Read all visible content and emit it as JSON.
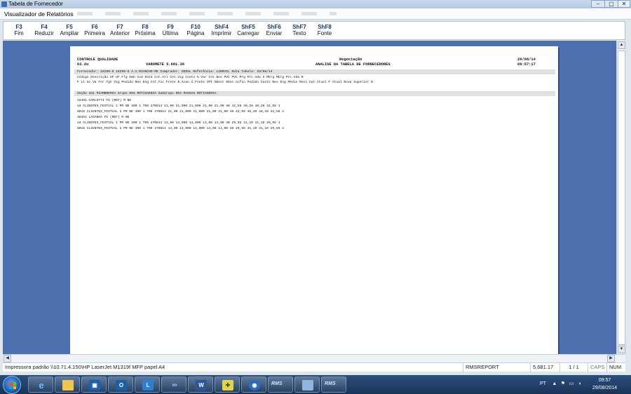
{
  "window": {
    "outer_title": "Tabela de Fornecedor",
    "inner_title": "Visualizador de Relatórios",
    "controls": [
      "–",
      "▢",
      "✕"
    ]
  },
  "toolbar": [
    {
      "key": "F3",
      "label": "Fim"
    },
    {
      "key": "F4",
      "label": "Reduzir"
    },
    {
      "key": "F5",
      "label": "Ampliar"
    },
    {
      "key": "F6",
      "label": "Primeira"
    },
    {
      "key": "F7",
      "label": "Anterior"
    },
    {
      "key": "F8",
      "label": "Próxima"
    },
    {
      "key": "F9",
      "label": "Última"
    },
    {
      "key": "F10",
      "label": "Página"
    },
    {
      "key": "ShF4",
      "label": "Imprimir"
    },
    {
      "key": "ShF5",
      "label": "Carregar"
    },
    {
      "key": "ShF6",
      "label": "Enviar"
    },
    {
      "key": "ShF7",
      "label": "Texto"
    },
    {
      "key": "ShF8",
      "label": "Fonte"
    }
  ],
  "report": {
    "header_left_1": "CONTROLE QUALIDADE",
    "header_left_2": "03.2u",
    "header_mid": "VAROMETE 5.681.36",
    "header_center_1": "Negociação",
    "header_center_2": "ANALISE DA TABELA DE FORNECEDORES",
    "date": "29/08/14",
    "time": "09:57:17",
    "band_1": "Fornecedor: 18299-5 18299-5 A.V.RIANCHO-ME          Comprador: GERAL                    Referência: LIBRAIL   Data Tabela: 29/08/14",
    "col_1": "Código  Descrição                            UF UF Flg Emb Cod  Data     Cst.Atl   Cst.Vig                                               Custo  % Var  Cst.Nov    PVC   PVC Mrg  Prc.Vda G    Mkrg   Mkrg  Prc.Vda N",
    "col_2": "                                             F Lt Uc Va     For Fgt  Vig    Pedido   Neo Eng  Cst.Fic  Frete  $.Acao  C.Fonte   IPI  %Desc %Dsc Acfin   Pedido  Custo  Neo Eng  Médio  Reco  Cat  Atual F   Atual  Nova Superior N",
    "section": "Seção   431 PIAMBREMIA              Grupo  004 ROTISSERIA                    SubGrupo  004 MASSAS ROTISSERIA",
    "rows": [
      {
        "text": "    18455  CARLETTI FG (REF)                      M NE",
        "kind": "item"
      },
      {
        "text": "       18  CLIENTES_FESTVAL 1                       PR NE 300   1 708  270814    21,00    21,000    21,000                                                    21,00             21,00              40  42,58     40,28  40,28    42,58 1",
        "kind": "line"
      },
      {
        "text": "     8015  CLIENTES_FESTVAL 2                       PR NE 300   1 708  270814    21,00    21,000    21,000                                                    21,00             21,00              40  42,58     40,28  40,28    42,58 2",
        "kind": "line"
      },
      {
        "text": "    38454  LASANHA FG (REF)                       M NE",
        "kind": "item"
      },
      {
        "text": "       18  CLIENTES_FESTVAL 1                       PR NE 300   1 709  270814    14,00    14,000    14,000                                                    14,00             14,00              40  29,65     41,10  41,10    29,65 1",
        "kind": "line"
      },
      {
        "text": "     8015  CLIENTES_FESTVAL 2                       PR NE 300   1 709  270814    14,00    14,000    14,000                                                    14,00             14,00              40  29,65     41,10  41,10    29,65 2",
        "kind": "line"
      }
    ]
  },
  "status": {
    "printer": "Impressora padrão \\\\10.71.4.150\\HP LaserJet M1319f MFP papel A4",
    "report_name": "RMSREPORT",
    "version": "5.681.17",
    "page": "1 / 1",
    "caps": "CAPS",
    "num": "NUM"
  },
  "taskbar": {
    "apps": [
      "ie",
      "explorer",
      "media",
      "outlook",
      "lync",
      "infinity",
      "word",
      "health",
      "security",
      "RMS",
      "window",
      "RMS"
    ],
    "tray_lang": "PT",
    "clock_time": "09:57",
    "clock_date": "29/08/2014"
  },
  "colors": {
    "workspace": "#4d6fad",
    "toolbar_key": "#17367a",
    "taskbar": "#1a3358"
  }
}
